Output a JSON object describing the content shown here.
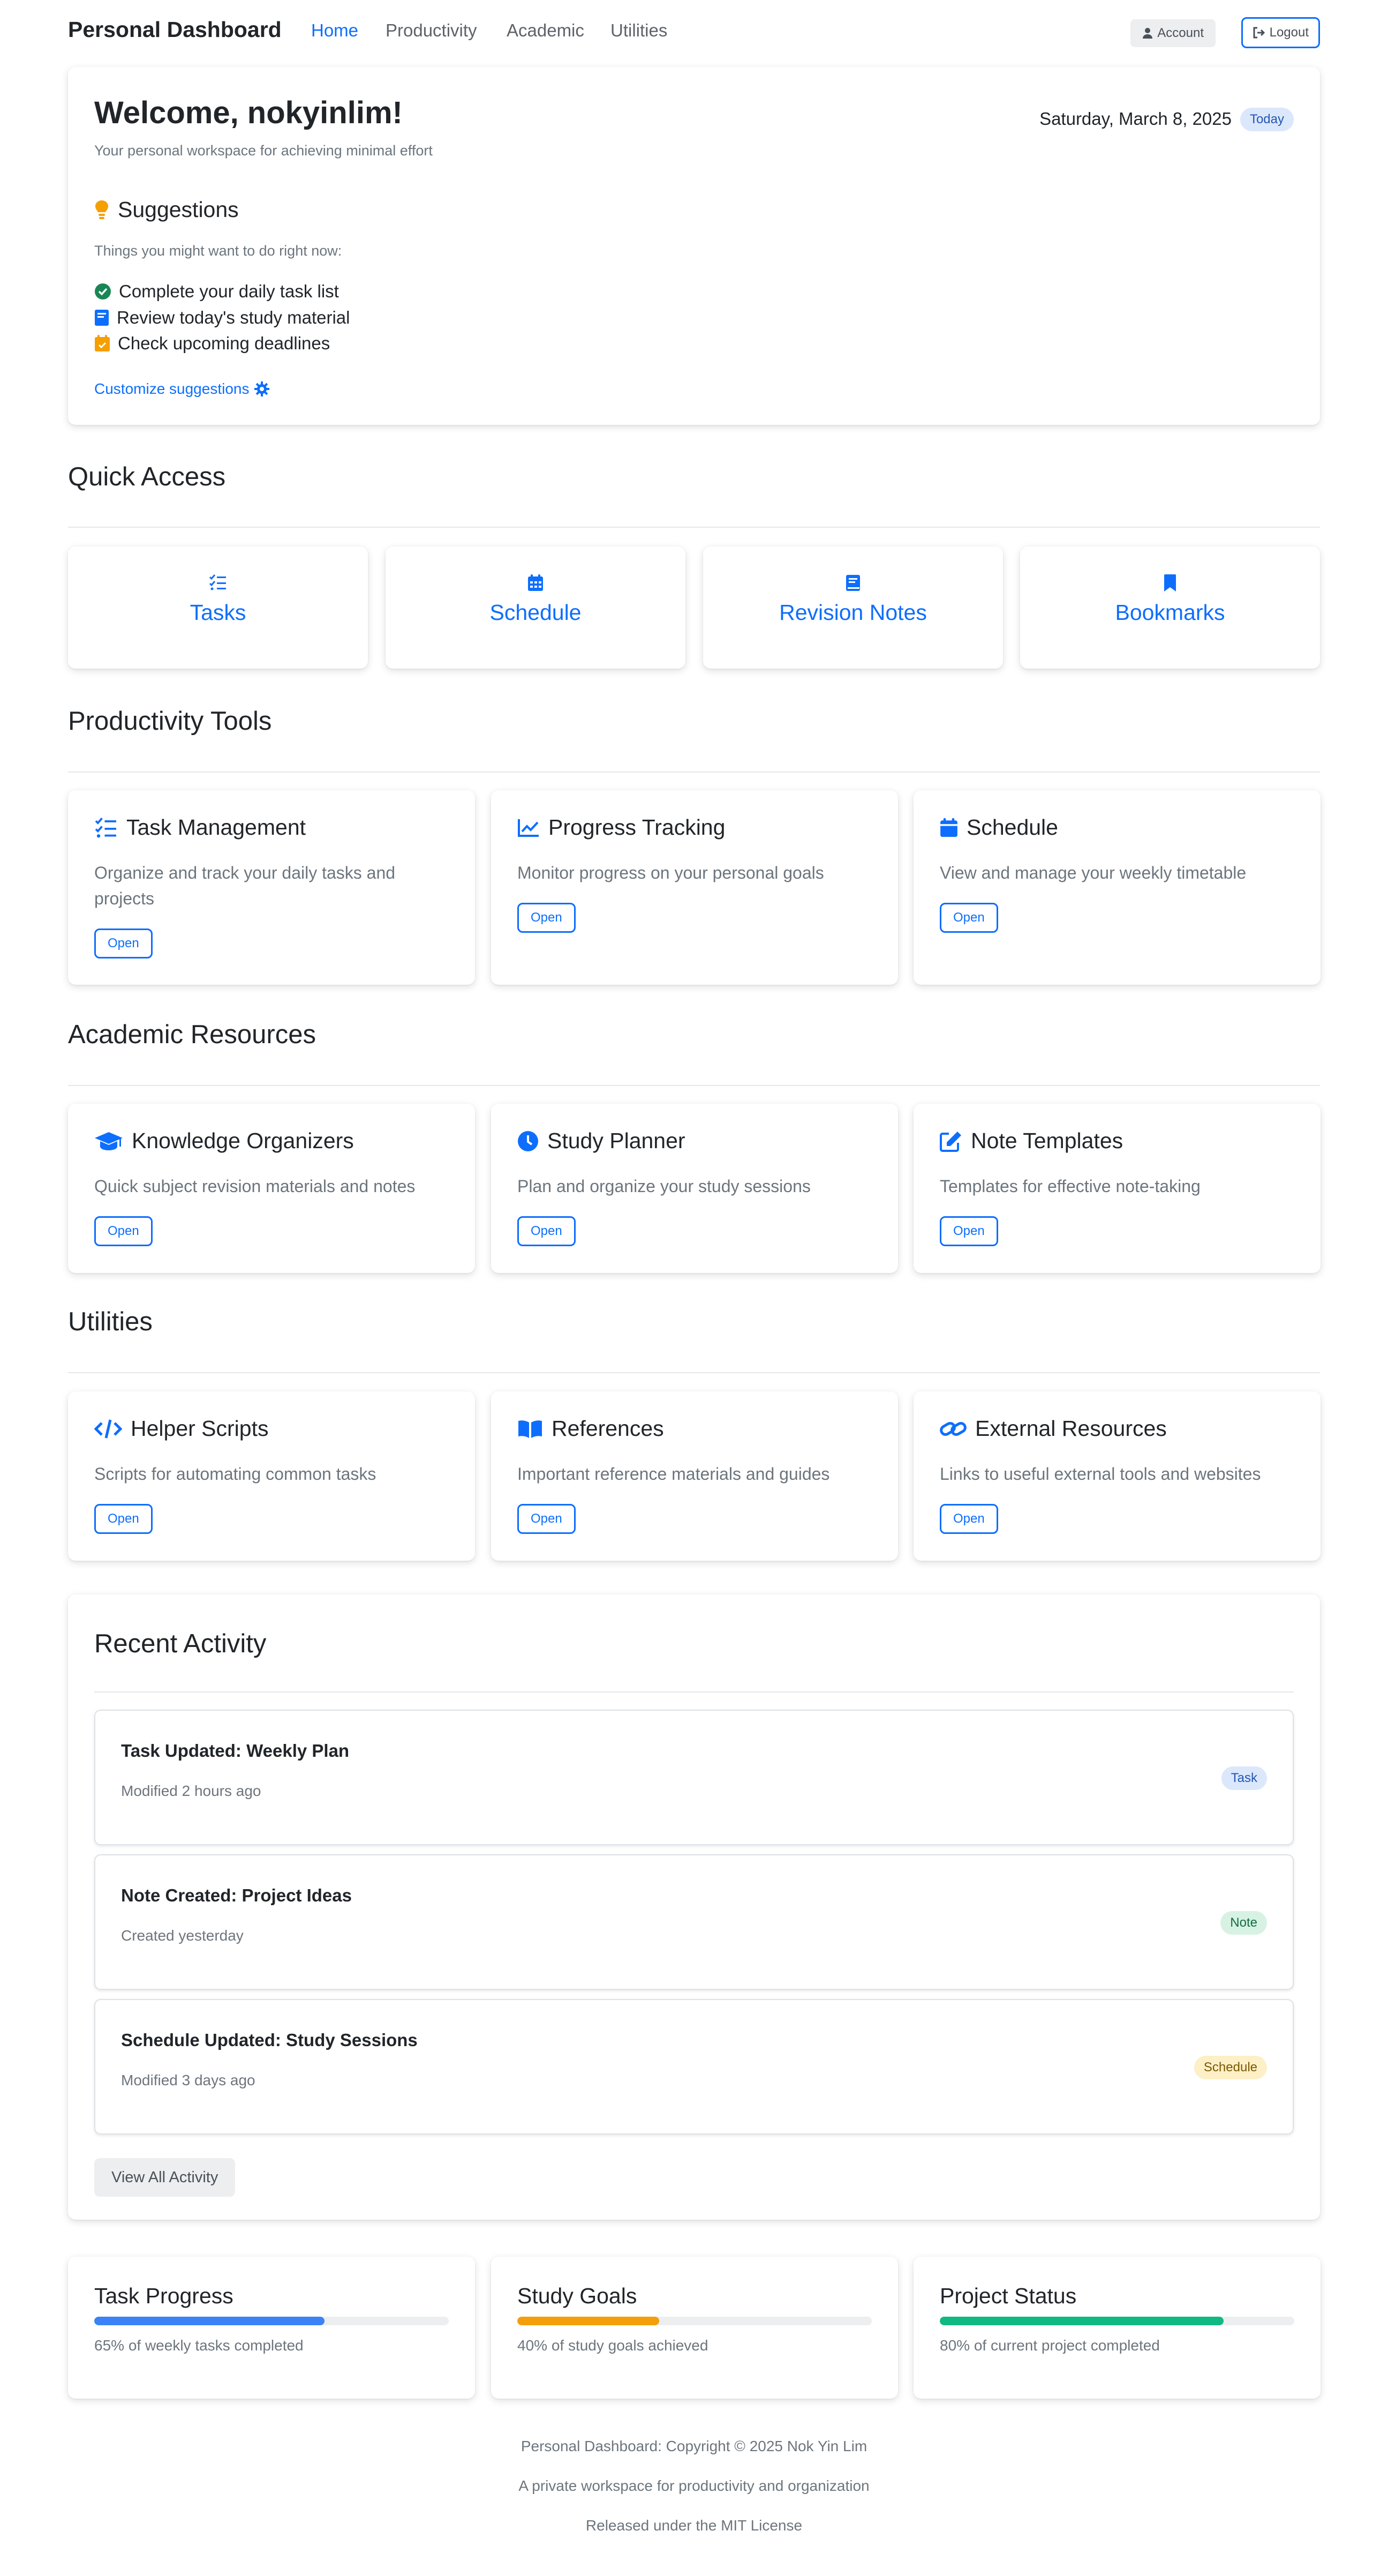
{
  "nav": {
    "brand": "Personal Dashboard",
    "links": [
      "Home",
      "Productivity",
      "Academic",
      "Utilities"
    ],
    "account_label": "Account",
    "logout_label": "Logout"
  },
  "welcome": {
    "title": "Welcome, nokyinlim!",
    "subtitle": "Your personal workspace for achieving minimal effort",
    "date": "Saturday, March 8, 2025",
    "today_badge": "Today",
    "suggestions_title": "Suggestions",
    "suggestions_subtitle": "Things you might want to do right now:",
    "suggestions": [
      {
        "label": "Complete your daily task list",
        "icon": "check-circle-icon",
        "color": "#198754"
      },
      {
        "label": "Review today's study material",
        "icon": "book-icon",
        "color": "#0d6efd"
      },
      {
        "label": "Check upcoming deadlines",
        "icon": "calendar-check-icon",
        "color": "#f59f00"
      }
    ],
    "customize_label": "Customize suggestions"
  },
  "quick_access": {
    "title": "Quick Access",
    "items": [
      {
        "label": "Tasks",
        "icon": "list-check-icon"
      },
      {
        "label": "Schedule",
        "icon": "calendar-icon"
      },
      {
        "label": "Revision Notes",
        "icon": "book-icon"
      },
      {
        "label": "Bookmarks",
        "icon": "bookmark-icon"
      }
    ]
  },
  "productivity": {
    "title": "Productivity Tools",
    "items": [
      {
        "title": "Task Management",
        "desc": "Organize and track your daily tasks and projects",
        "icon": "list-check-icon",
        "button": "Open"
      },
      {
        "title": "Progress Tracking",
        "desc": "Monitor progress on your personal goals",
        "icon": "chart-line-icon",
        "button": "Open"
      },
      {
        "title": "Schedule",
        "desc": "View and manage your weekly timetable",
        "icon": "calendar-icon",
        "button": "Open"
      }
    ]
  },
  "academic": {
    "title": "Academic Resources",
    "items": [
      {
        "title": "Knowledge Organizers",
        "desc": "Quick subject revision materials and notes",
        "icon": "graduation-cap-icon",
        "button": "Open"
      },
      {
        "title": "Study Planner",
        "desc": "Plan and organize your study sessions",
        "icon": "clock-icon",
        "button": "Open"
      },
      {
        "title": "Note Templates",
        "desc": "Templates for effective note-taking",
        "icon": "edit-icon",
        "button": "Open"
      }
    ]
  },
  "utilities": {
    "title": "Utilities",
    "items": [
      {
        "title": "Helper Scripts",
        "desc": "Scripts for automating common tasks",
        "icon": "code-icon",
        "button": "Open"
      },
      {
        "title": "References",
        "desc": "Important reference materials and guides",
        "icon": "book-open-icon",
        "button": "Open"
      },
      {
        "title": "External Resources",
        "desc": "Links to useful external tools and websites",
        "icon": "link-icon",
        "button": "Open"
      }
    ]
  },
  "activity": {
    "title": "Recent Activity",
    "items": [
      {
        "title": "Task Updated: Weekly Plan",
        "time": "Modified 2 hours ago",
        "badge": "Task",
        "badge_bg": "#dbe7fb",
        "badge_color": "#2457b3"
      },
      {
        "title": "Note Created: Project Ideas",
        "time": "Created yesterday",
        "badge": "Note",
        "badge_bg": "#d7f2e3",
        "badge_color": "#146c43"
      },
      {
        "title": "Schedule Updated: Study Sessions",
        "time": "Modified 3 days ago",
        "badge": "Schedule",
        "badge_bg": "#fdefc6",
        "badge_color": "#7a5a00"
      }
    ],
    "view_all_label": "View All Activity"
  },
  "progress": [
    {
      "title": "Task Progress",
      "percent": 65,
      "text": "65% of weekly tasks completed",
      "color": "#3b82f6"
    },
    {
      "title": "Study Goals",
      "percent": 40,
      "text": "40% of study goals achieved",
      "color": "#f59e0b"
    },
    {
      "title": "Project Status",
      "percent": 80,
      "text": "80% of current project completed",
      "color": "#10b981"
    }
  ],
  "footer": {
    "copyright": "Personal Dashboard: Copyright © 2025 Nok Yin Lim",
    "tagline": "A private workspace for productivity and organization",
    "license": "Released under the MIT License"
  }
}
